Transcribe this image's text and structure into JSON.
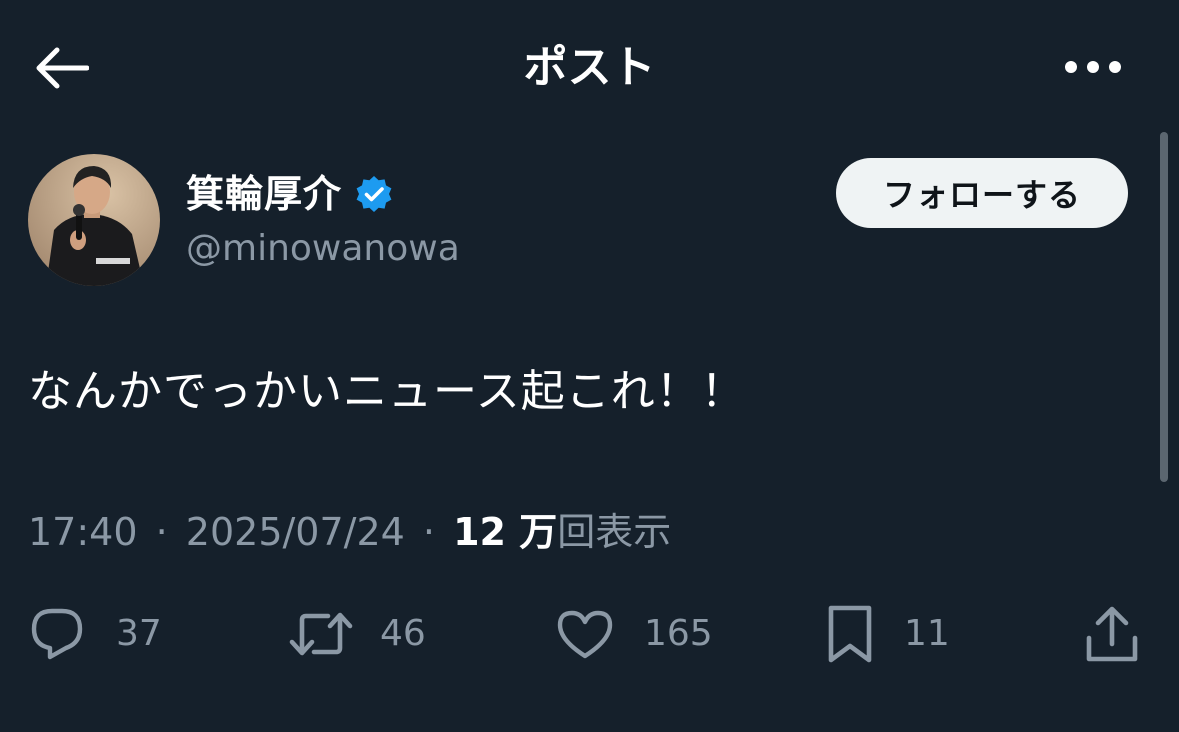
{
  "header": {
    "title": "ポスト",
    "back_icon": "arrow-left-icon",
    "more_icon": "more-horizontal-icon"
  },
  "author": {
    "name": "箕輪厚介",
    "handle": "@minowanowa",
    "verified_icon": "verified-badge-icon",
    "verified_color": "#1d9bf0",
    "follow_label": "フォローする"
  },
  "post": {
    "text": "なんかでっかいニュース起これ！！"
  },
  "meta": {
    "time": "17:40",
    "separator": "·",
    "date": "2025/07/24",
    "views_count": "12 万",
    "views_label": "回表示"
  },
  "actions": {
    "reply": {
      "icon": "reply-icon",
      "count": "37"
    },
    "repost": {
      "icon": "repost-icon",
      "count": "46"
    },
    "like": {
      "icon": "heart-icon",
      "count": "165"
    },
    "bookmark": {
      "icon": "bookmark-icon",
      "count": "11"
    },
    "share": {
      "icon": "share-icon"
    }
  },
  "colors": {
    "background": "#15202b",
    "secondary_text": "#8b98a5",
    "follow_button_bg": "#eff3f4"
  }
}
